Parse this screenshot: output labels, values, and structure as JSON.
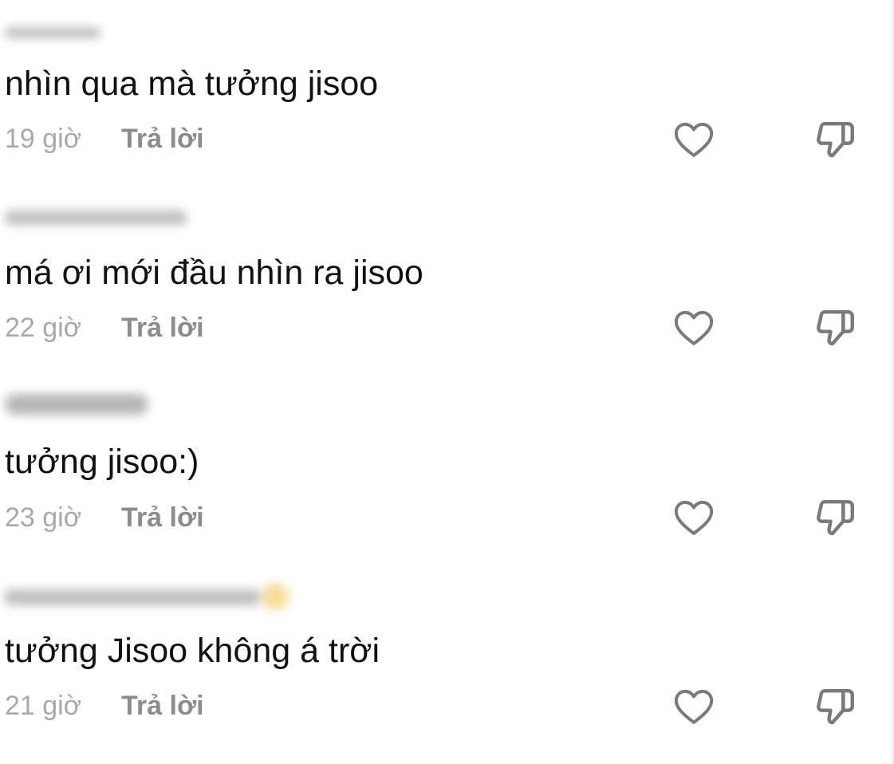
{
  "comments": [
    {
      "text": "nhìn qua mà tưởng jisoo",
      "time": "19 giờ",
      "reply_label": "Trả lời"
    },
    {
      "text": "má ơi mới đầu nhìn ra jisoo",
      "time": "22 giờ",
      "reply_label": "Trả lời"
    },
    {
      "text": "tưởng jisoo:)",
      "time": "23 giờ",
      "reply_label": "Trả lời"
    },
    {
      "text": "tưởng Jisoo không á trời",
      "time": "21 giờ",
      "reply_label": "Trả lời"
    }
  ],
  "icons": {
    "like": "heart-outline-icon",
    "dislike": "thumbs-down-icon"
  },
  "colors": {
    "text": "#111111",
    "muted": "#a9a9a9",
    "reply": "#8c8c8c",
    "icon": "#7a7a7a"
  }
}
